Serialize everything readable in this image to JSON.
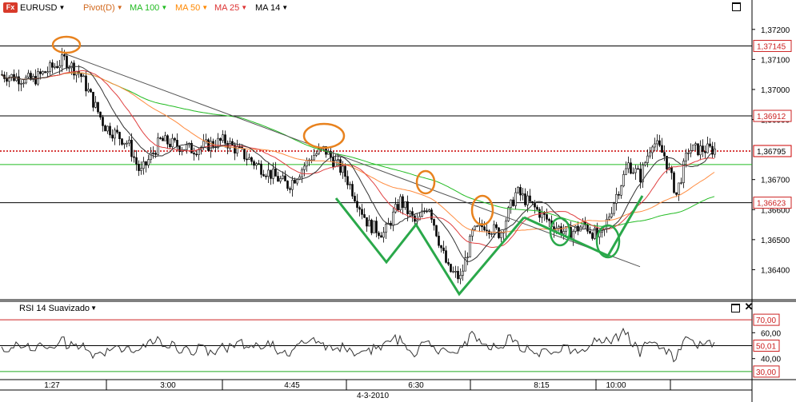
{
  "toolbar": {
    "symbol": "EURUSD",
    "fx_badge": "Fx",
    "indicators": [
      {
        "label": "Pivot(D)",
        "color": "#d2691e"
      },
      {
        "label": "MA 100",
        "color": "#22bb22"
      },
      {
        "label": "MA 50",
        "color": "#ff8800"
      },
      {
        "label": "MA 25",
        "color": "#dd3333"
      },
      {
        "label": "MA 14",
        "color": "#000000"
      }
    ]
  },
  "rsi_panel": {
    "title": "RSI 14 Suavizado"
  },
  "colors": {
    "up_candle": "#ffffff",
    "down_candle": "#000000",
    "price_line": "#ff0000",
    "ma100": "#22bb22",
    "ma50": "#ff8c40",
    "ma25": "#e04040",
    "ma14": "#333333",
    "pattern_green": "#2aa84a",
    "pattern_orange": "#e8821e",
    "rsi_line": "#333333",
    "pivot_label": "#cc2222"
  },
  "chart_data": [
    {
      "type": "candlestick",
      "symbol": "EURUSD",
      "x_ticks": [
        "1:27",
        "3:00",
        "4:45",
        "6:30",
        "8:15",
        "10:00"
      ],
      "date_label": "4-3-2010",
      "y_ticks": [
        "1,37200",
        "1,37100",
        "1,37000",
        "1,36900",
        "1,36700",
        "1,36600",
        "1,36500",
        "1,36400"
      ],
      "ylim": [
        1.363,
        1.3725
      ],
      "levels": [
        {
          "label": "1,37145",
          "value": 1.37145,
          "kind": "pivot"
        },
        {
          "label": "1,36912",
          "value": 1.36912,
          "kind": "pivot"
        },
        {
          "label": "1,36795",
          "value": 1.36795,
          "kind": "current-price"
        },
        {
          "label": "1,36623",
          "value": 1.36623,
          "kind": "pivot"
        }
      ],
      "series": [
        {
          "name": "MA 100"
        },
        {
          "name": "MA 50"
        },
        {
          "name": "MA 25"
        },
        {
          "name": "MA 14"
        }
      ],
      "price_path": [
        [
          0,
          1.3705
        ],
        [
          40,
          1.3703
        ],
        [
          80,
          1.371
        ],
        [
          100,
          1.3705
        ],
        [
          130,
          1.3688
        ],
        [
          160,
          1.3682
        ],
        [
          175,
          1.3672
        ],
        [
          200,
          1.3683
        ],
        [
          240,
          1.368
        ],
        [
          280,
          1.3683
        ],
        [
          320,
          1.3675
        ],
        [
          360,
          1.3668
        ],
        [
          390,
          1.3678
        ],
        [
          405,
          1.368
        ],
        [
          430,
          1.3672
        ],
        [
          460,
          1.3655
        ],
        [
          480,
          1.3652
        ],
        [
          500,
          1.3663
        ],
        [
          520,
          1.3655
        ],
        [
          535,
          1.3662
        ],
        [
          550,
          1.3648
        ],
        [
          560,
          1.364
        ],
        [
          575,
          1.3637
        ],
        [
          590,
          1.3652
        ],
        [
          605,
          1.3655
        ],
        [
          625,
          1.3652
        ],
        [
          645,
          1.3666
        ],
        [
          670,
          1.366
        ],
        [
          690,
          1.3655
        ],
        [
          710,
          1.3652
        ],
        [
          730,
          1.3655
        ],
        [
          750,
          1.365
        ],
        [
          770,
          1.3665
        ],
        [
          785,
          1.3675
        ],
        [
          800,
          1.3671
        ],
        [
          815,
          1.3683
        ],
        [
          830,
          1.3678
        ],
        [
          845,
          1.3665
        ],
        [
          860,
          1.368
        ],
        [
          875,
          1.368
        ],
        [
          893,
          1.368
        ]
      ]
    },
    {
      "type": "line",
      "title": "RSI 14 Suavizado",
      "y_ticks": [
        "70,00",
        "60,00",
        "50,01",
        "40,00",
        "30,00"
      ],
      "ylim": [
        25,
        75
      ],
      "levels": [
        {
          "label": "70,00",
          "value": 70
        },
        {
          "label": "50,01",
          "value": 50.01
        },
        {
          "label": "30,00",
          "value": 30
        }
      ]
    }
  ]
}
